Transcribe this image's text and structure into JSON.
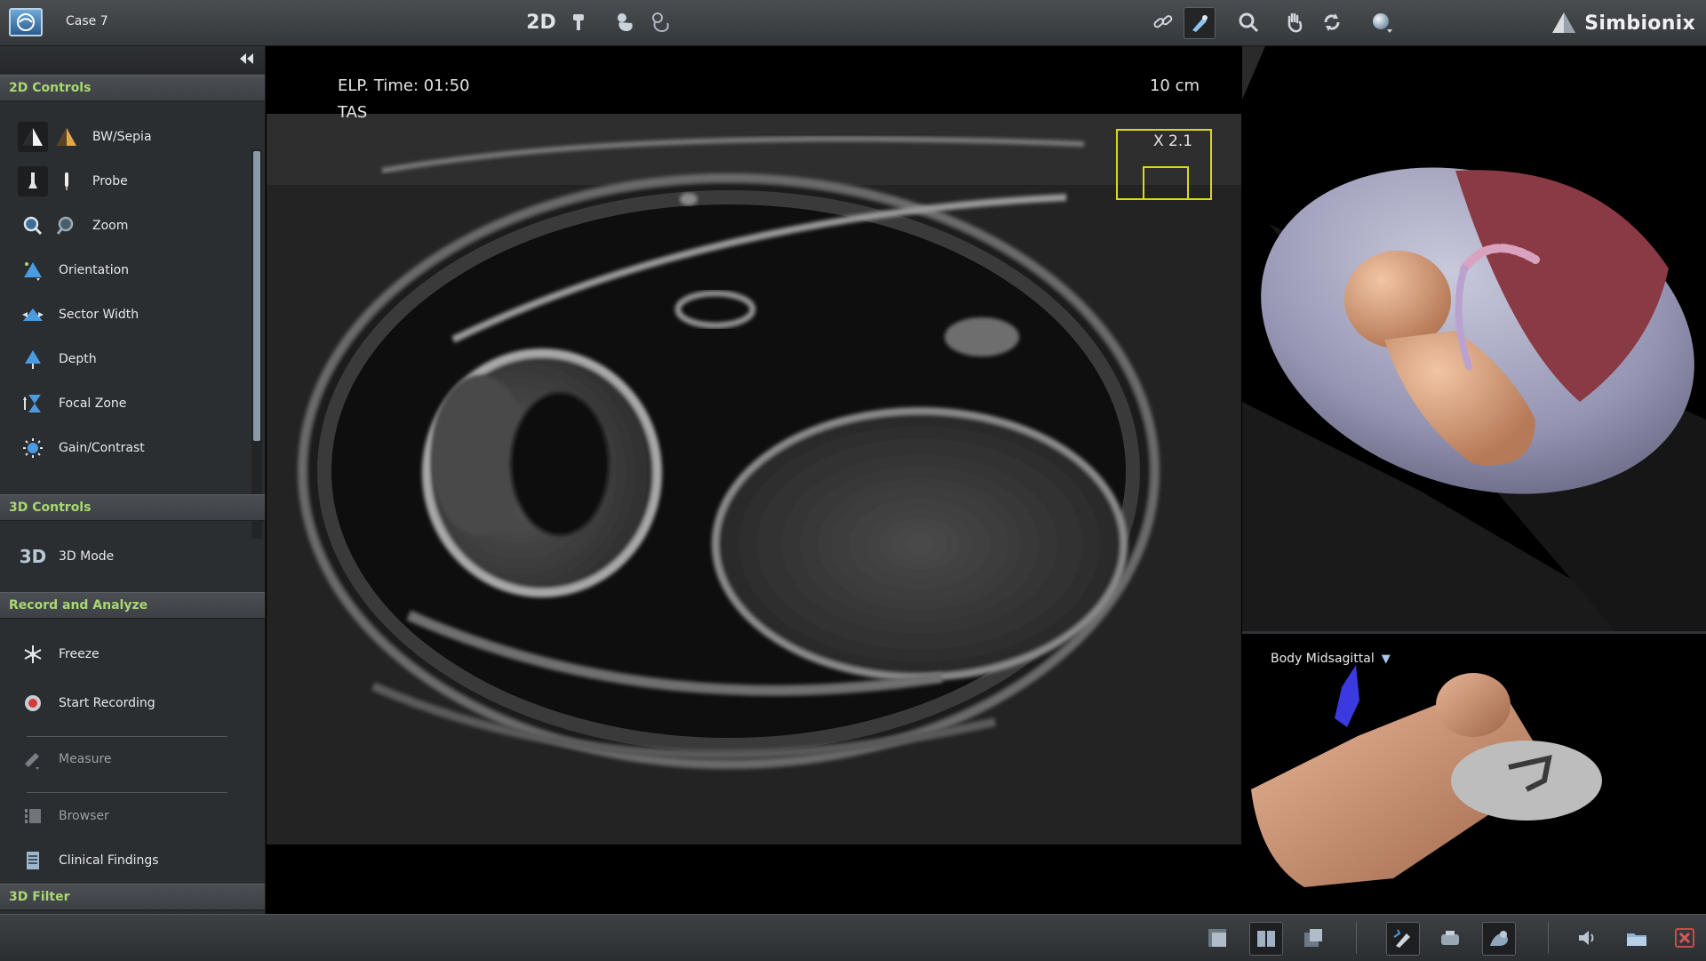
{
  "header": {
    "case_title": "Case 7",
    "mode_label": "2D",
    "brand_name": "Simbionix",
    "tools": [
      {
        "name": "mode-2d-button",
        "icon": "2d-mode-icon"
      },
      {
        "name": "probe-marker-button",
        "icon": "probe-pin-icon"
      },
      {
        "name": "fetus-view-button",
        "icon": "fetus-icon"
      },
      {
        "name": "fetus-outline-button",
        "icon": "fetus-outline-icon"
      },
      {
        "name": "link-button",
        "icon": "link-icon"
      },
      {
        "name": "probe-tool-button",
        "icon": "probe-tool-icon"
      },
      {
        "name": "magnify-button",
        "icon": "magnify-icon"
      },
      {
        "name": "pan-button",
        "icon": "hand-icon"
      },
      {
        "name": "rotate-button",
        "icon": "rotate-icon"
      },
      {
        "name": "sphere-view-button",
        "icon": "sphere-icon"
      }
    ]
  },
  "sidebar": {
    "sections": {
      "controls_2d": "2D Controls",
      "controls_3d": "3D Controls",
      "record_analyze": "Record and Analyze",
      "filter_3d": "3D Filter"
    },
    "items_2d": [
      {
        "label": "BW/Sepia",
        "icon": "bw-sepia-icon"
      },
      {
        "label": "Probe",
        "icon": "probe-icon"
      },
      {
        "label": "Zoom",
        "icon": "zoom-icon"
      },
      {
        "label": "Orientation",
        "icon": "orientation-icon"
      },
      {
        "label": "Sector Width",
        "icon": "sector-width-icon"
      },
      {
        "label": "Depth",
        "icon": "depth-icon"
      },
      {
        "label": "Focal Zone",
        "icon": "focal-zone-icon"
      },
      {
        "label": "Gain/Contrast",
        "icon": "gain-contrast-icon"
      }
    ],
    "items_3d": [
      {
        "label": "3D Mode",
        "icon": "3d-mode-icon",
        "glyph": "3D"
      }
    ],
    "items_record": [
      {
        "label": "Freeze",
        "icon": "freeze-icon"
      },
      {
        "label": "Start Recording",
        "icon": "record-icon"
      },
      {
        "label": "Measure",
        "icon": "measure-icon"
      },
      {
        "label": "Browser",
        "icon": "browser-icon"
      },
      {
        "label": "Clinical Findings",
        "icon": "clinical-findings-icon"
      }
    ]
  },
  "ultrasound": {
    "elapsed_time": "ELP. Time: 01:50",
    "scan_mode": "TAS",
    "depth": "10 cm",
    "zoom_factor": "X 2.1"
  },
  "mini_view": {
    "title": "Body Midsagittal",
    "dropdown_glyph": "▼"
  },
  "bottombar": {
    "tools": [
      {
        "name": "layout-single-button",
        "icon": "single-view-icon"
      },
      {
        "name": "layout-split-button",
        "icon": "split-view-icon"
      },
      {
        "name": "layout-overlay-button",
        "icon": "overlay-view-icon"
      },
      {
        "name": "probe-mode-button",
        "icon": "probe-mode-icon"
      },
      {
        "name": "camera-mode-button",
        "icon": "camera-mode-icon"
      },
      {
        "name": "virtual-patient-button",
        "icon": "virtual-patient-icon"
      },
      {
        "name": "sound-button",
        "icon": "speaker-icon"
      },
      {
        "name": "open-folder-button",
        "icon": "folder-icon"
      },
      {
        "name": "exit-button",
        "icon": "close-icon"
      }
    ]
  },
  "colors": {
    "section_header_text": "#a8d870",
    "zoom_box": "#d8d81f",
    "accent_blue": "#4a9be0"
  }
}
